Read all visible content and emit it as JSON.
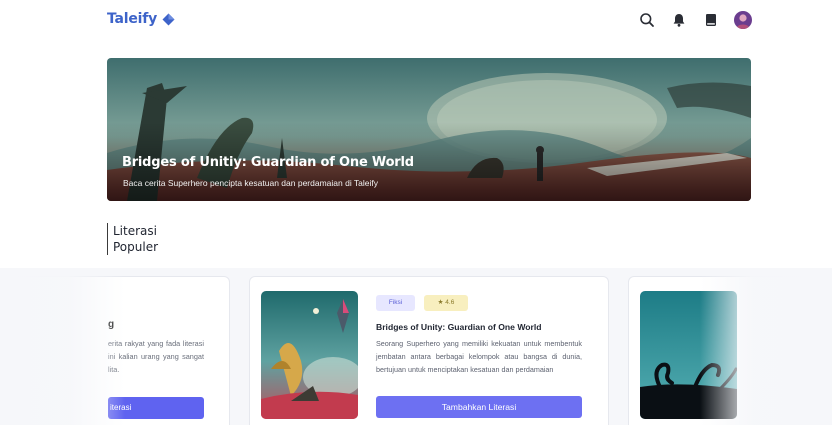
{
  "header": {
    "logo_text": "Taleify",
    "icons": [
      "search-icon",
      "bell-icon",
      "book-icon",
      "avatar"
    ]
  },
  "hero": {
    "title": "Bridges of Unitiy: Guardian of One World",
    "subtitle": "Baca cerita Superhero pencipta kesatuan dan perdamaian di Taleify"
  },
  "section": {
    "title_line1": "Literasi",
    "title_line2": "Populer"
  },
  "card_left": {
    "title_fragment": "g",
    "desc": "erita rakyat yang fada literasi ini kalian urang yang sangat lita.",
    "button_label": "iterasi"
  },
  "card_main": {
    "genre_tag": "Fiksi",
    "rating": "4.6",
    "title": "Bridges of Unity: Guardian of One World",
    "description": "Seorang Superhero yang memiliki kekuatan untuk membentuk jembatan antara berbagai kelompok atau bangsa di dunia, bertujuan untuk menciptakan kesatuan dan perdamaian",
    "button_label": "Tambahkan Literasi"
  },
  "colors": {
    "brand": "#3d63c9",
    "button": "#6d70f2",
    "tag_genre_bg": "#e7e7ff",
    "tag_rating_bg": "#f8efbf"
  }
}
